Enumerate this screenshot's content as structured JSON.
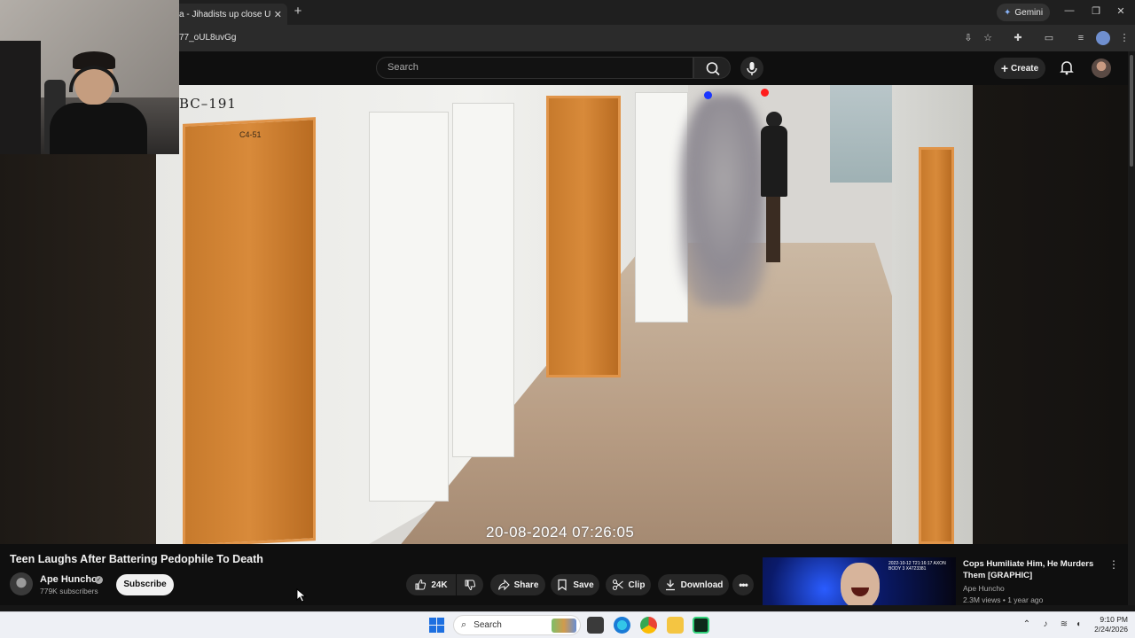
{
  "browser": {
    "tab_title": "a - Jihadists up close UNCE",
    "tab_close": "✕",
    "new_tab": "+",
    "gemini_label": "Gemini",
    "url": "77_oUL8uvGg"
  },
  "youtube": {
    "search_placeholder": "Search",
    "create_label": "Create"
  },
  "video": {
    "camera_label": "BC–191",
    "door_number": "C4-51",
    "timestamp": "20-08-2024 07:26:05"
  },
  "watch": {
    "title": "Teen Laughs After Battering Pedophile To Death",
    "channel_name": "Ape Huncho",
    "subscribers": "779K subscribers",
    "subscribe_label": "Subscribe",
    "like_count": "24K",
    "share_label": "Share",
    "save_label": "Save",
    "clip_label": "Clip",
    "download_label": "Download"
  },
  "recommendation": {
    "title": "Cops Humiliate Him, He Murders Them [GRAPHIC]",
    "channel": "Ape Huncho",
    "meta": "2.3M views • 1 year ago",
    "overlay_text": "2022-10-12 T21:16:17 AXON BODY 3 X4723381"
  },
  "taskbar": {
    "search_label": "Search",
    "time": "9:10 PM",
    "date": "2/24/2026"
  },
  "colors": {
    "youtube_bg": "#0f0f0f",
    "door_orange": "#d88a3a",
    "tracker_blue": "#1a36ff",
    "tracker_red": "#ff1c1c"
  }
}
